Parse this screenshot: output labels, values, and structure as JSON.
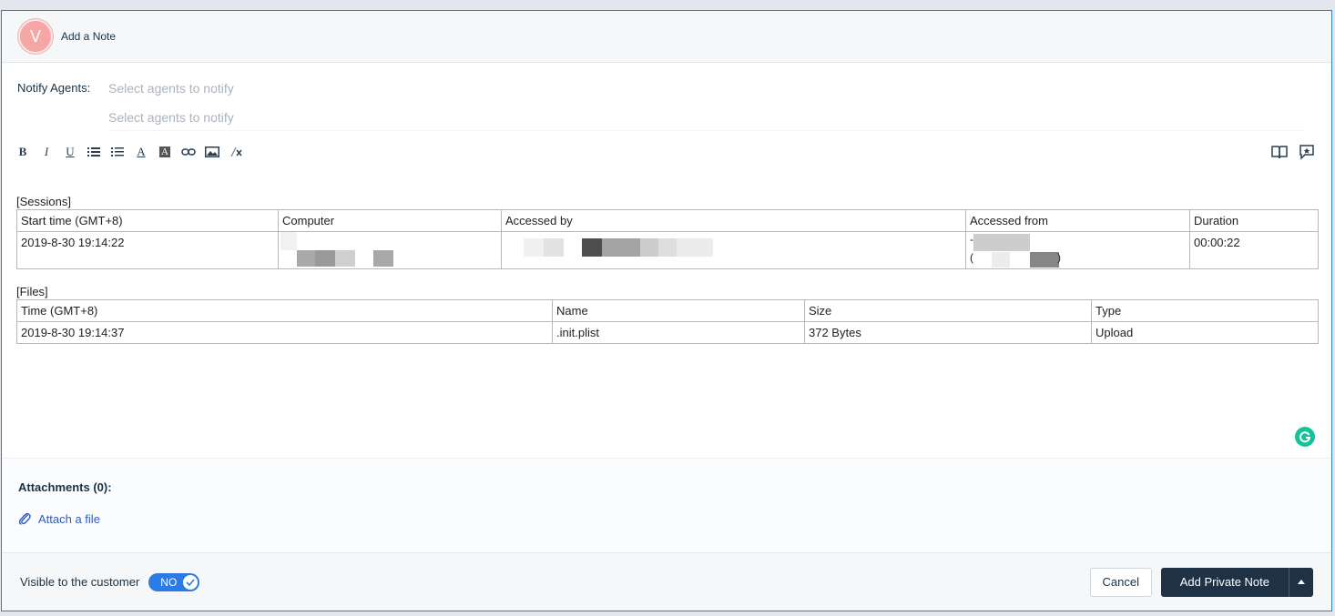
{
  "header": {
    "avatar_initial": "V",
    "title": "Add a Note"
  },
  "notify": {
    "label": "Notify Agents:",
    "placeholder_1": "Select agents to notify",
    "placeholder_2": "Select agents to notify"
  },
  "toolbar": {
    "bold": "B",
    "italic": "I",
    "underline": "U",
    "font_color": "A",
    "bg_color": "A",
    "icons_left": [
      "bold-icon",
      "italic-icon",
      "underline-icon",
      "bullet-list-icon",
      "numbered-list-icon",
      "font-color-icon",
      "background-color-icon",
      "link-icon",
      "image-icon",
      "clear-format-icon"
    ],
    "icons_right": [
      "book-icon",
      "star-comment-icon"
    ]
  },
  "sessions": {
    "label": "[Sessions]",
    "headers": [
      "Start time (GMT+8)",
      "Computer",
      "Accessed by",
      "Accessed from",
      "Duration"
    ],
    "row": {
      "start_time": "2019-8-30 19:14:22",
      "accessed_from_prefix_1": "-",
      "accessed_from_paren_open": "(",
      "accessed_from_paren_close": ")",
      "duration": "00:00:22"
    }
  },
  "files": {
    "label": "[Files]",
    "headers": [
      "Time (GMT+8)",
      "Name",
      "Size",
      "Type"
    ],
    "rows": [
      [
        "2019-8-30 19:14:37",
        ".init.plist",
        "372 Bytes",
        "Upload"
      ]
    ]
  },
  "attachments": {
    "title": "Attachments (0):",
    "link": "Attach a file"
  },
  "footer": {
    "visible_label": "Visible to the customer",
    "toggle_label": "NO",
    "cancel": "Cancel",
    "primary": "Add Private Note"
  },
  "colors": {
    "accent": "#2c7be5",
    "primary_button": "#1f3145",
    "avatar": "#f7a6a6",
    "grammarly": "#15c39a"
  }
}
